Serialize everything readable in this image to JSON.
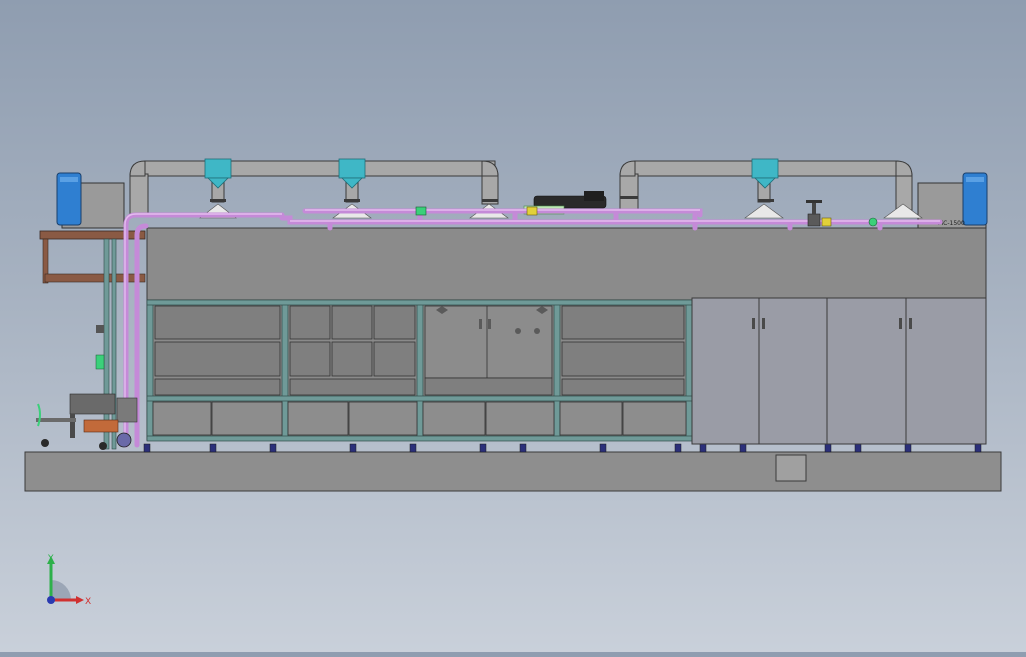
{
  "viewport": {
    "background_top": "#8f9db0",
    "background_bottom": "#c9d0da"
  },
  "machine": {
    "nameplate": "MC-1500",
    "colors": {
      "frame": "#5f8f8f",
      "panel": "#8c8c8c",
      "cabinet": "#9a9ca6",
      "duct": "#a9a9a9",
      "duct_joint": "#3fb7c6",
      "pipe": "#c58ad8",
      "filter_tank": "#2f7fd1",
      "base": "#8d8d8d",
      "pump": "#2a2a2a"
    }
  },
  "triad": {
    "x_label": "X",
    "y_label": "Y"
  }
}
